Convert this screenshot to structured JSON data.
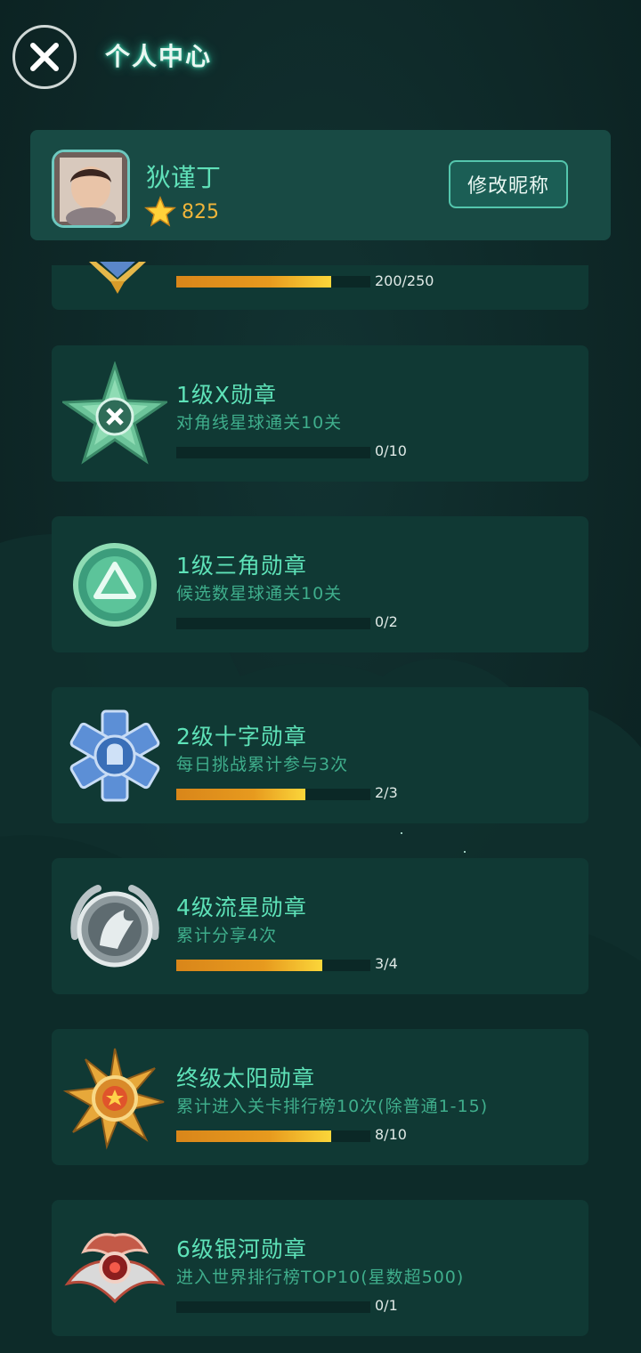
{
  "header": {
    "title": "个人中心"
  },
  "profile": {
    "username": "狄谨丁",
    "score": "825",
    "edit_label": "修改昵称"
  },
  "medals": [
    {
      "icon": "gold-chevron-medal-icon",
      "name": "",
      "desc": "",
      "progress_text": "200/250",
      "progress": 0.8
    },
    {
      "icon": "green-star-x-medal-icon",
      "name": "1级X勋章",
      "desc": "对角线星球通关10关",
      "progress_text": "0/10",
      "progress": 0
    },
    {
      "icon": "green-triangle-medal-icon",
      "name": "1级三角勋章",
      "desc": "候选数星球通关10关",
      "progress_text": "0/2",
      "progress": 0
    },
    {
      "icon": "blue-cross-medal-icon",
      "name": "2级十字勋章",
      "desc": "每日挑战累计参与3次",
      "progress_text": "2/3",
      "progress": 0.667
    },
    {
      "icon": "silver-meteor-medal-icon",
      "name": "4级流星勋章",
      "desc": "累计分享4次",
      "progress_text": "3/4",
      "progress": 0.75
    },
    {
      "icon": "gold-sun-medal-icon",
      "name": "终级太阳勋章",
      "desc": "累计进入关卡排行榜10次(除普通1-15)",
      "progress_text": "8/10",
      "progress": 0.8
    },
    {
      "icon": "red-galaxy-medal-icon",
      "name": "6级银河勋章",
      "desc": "进入世界排行榜TOP10(星数超500)",
      "progress_text": "0/1",
      "progress": 0
    }
  ],
  "colors": {
    "background": "#0c2322",
    "card": "#103934",
    "accent": "#5ee2b8",
    "progress_fill": "#fbd63a"
  }
}
